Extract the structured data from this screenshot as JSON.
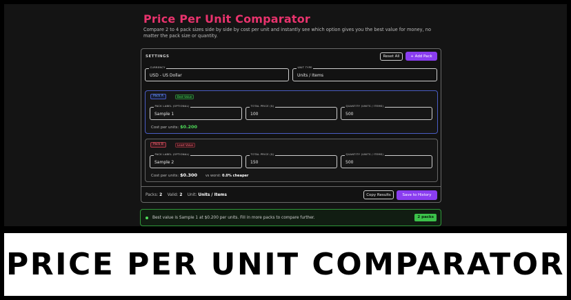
{
  "app": {
    "title": "Price Per Unit Comparator",
    "description": "Compare 2 to 4 pack sizes side by side by cost per unit and instantly see which option gives you the best value for money, no matter the pack size or quantity."
  },
  "settings": {
    "heading": "SETTINGS",
    "reset_label": "Reset All",
    "add_label": "+ Add Pack",
    "currency": {
      "legend": "CURRENCY",
      "value": "USD - US Dollar"
    },
    "unit_type": {
      "legend": "UNIT TYPE",
      "value": "Units / Items"
    }
  },
  "packs": [
    {
      "badge": "Pack A",
      "tag": "Best Value",
      "label": {
        "legend": "PACK LABEL (OPTIONAL)",
        "value": "Sample 1"
      },
      "price": {
        "legend": "TOTAL PRICE ($)",
        "value": "100"
      },
      "quantity": {
        "legend": "QUANTITY (UNITS / ITEMS)",
        "value": "500"
      },
      "cpu_label": "Cost per units:",
      "cpu_value": "$0.200"
    },
    {
      "badge": "Pack B",
      "tag": "Least Value",
      "label": {
        "legend": "PACK LABEL (OPTIONAL)",
        "value": "Sample 2"
      },
      "price": {
        "legend": "TOTAL PRICE ($)",
        "value": "150"
      },
      "quantity": {
        "legend": "QUANTITY (UNITS / ITEMS)",
        "value": "500"
      },
      "cpu_label": "Cost per units:",
      "cpu_value": "$0.300",
      "vs_label": "vs worst:",
      "vs_value": "0.0% cheaper"
    }
  ],
  "footer": {
    "packs_label": "Packs:",
    "packs_value": "2",
    "valid_label": "Valid:",
    "valid_value": "2",
    "unit_label": "Unit:",
    "unit_value": "Units / Items",
    "copy_label": "Copy Results",
    "save_label": "Save to History"
  },
  "status": {
    "message": "Best value is Sample 1 at $0.200 per units. Fill in more packs to compare further.",
    "badge": "2 packs"
  },
  "banner": {
    "text": "PRICE PER UNIT COMPARATOR"
  },
  "colors": {
    "accent_pink": "#e8336d",
    "accent_purple": "#8a3df0",
    "best_green": "#4fdc5a",
    "least_red": "#ff6e7a"
  }
}
